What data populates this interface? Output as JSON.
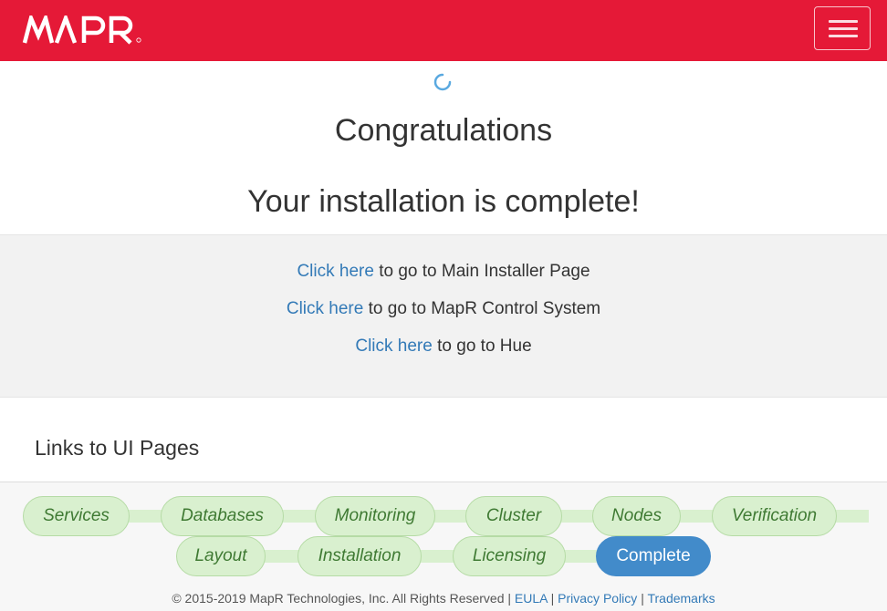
{
  "brand": {
    "logo_text": "MAPR",
    "primary_color": "#e51937",
    "link_color": "#337ab7"
  },
  "header": {
    "menu_icon": "hamburger-menu-icon"
  },
  "status": {
    "spinner_icon": "loading-spinner-icon"
  },
  "main": {
    "heading": "Congratulations",
    "subheading": "Your installation is complete!"
  },
  "links": [
    {
      "link_text": "Click here",
      "suffix": " to go to Main Installer Page"
    },
    {
      "link_text": "Click here",
      "suffix": " to go to MapR Control System"
    },
    {
      "link_text": "Click here",
      "suffix": " to go to Hue"
    }
  ],
  "ui_pages": {
    "heading": "Links to UI Pages",
    "row1": [
      "Services",
      "Databases",
      "Monitoring",
      "Cluster",
      "Nodes",
      "Verification"
    ],
    "row2": [
      "Layout",
      "Installation",
      "Licensing",
      "Complete"
    ],
    "active": "Complete"
  },
  "footer": {
    "copyright": "© 2015-2019 MapR Technologies, Inc. All Rights Reserved",
    "separator": "|",
    "eula": "EULA",
    "privacy": "Privacy Policy",
    "trademarks": "Trademarks"
  }
}
